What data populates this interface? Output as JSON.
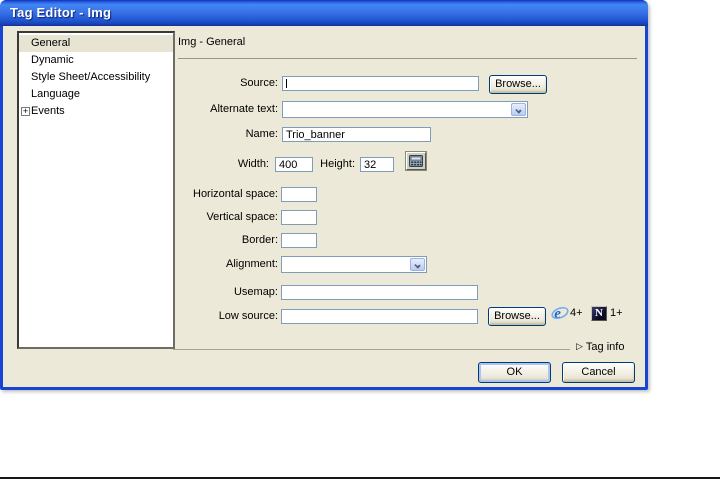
{
  "window": {
    "title": "Tag Editor - Img"
  },
  "sidebar": {
    "expander_glyph": "+",
    "items": [
      {
        "label": "General",
        "selected": true
      },
      {
        "label": "Dynamic"
      },
      {
        "label": "Style Sheet/Accessibility"
      },
      {
        "label": "Language"
      },
      {
        "label": "Events",
        "expandable": true
      }
    ]
  },
  "panel": {
    "header": "Img - General"
  },
  "form": {
    "source": {
      "label": "Source:",
      "value": "",
      "browse_label": "Browse..."
    },
    "alternate_text": {
      "label": "Alternate text:",
      "value": ""
    },
    "name": {
      "label": "Name:",
      "value": "Trio_banner"
    },
    "width": {
      "label": "Width:",
      "value": "400"
    },
    "height": {
      "label": "Height:",
      "value": "32"
    },
    "horizontal_space": {
      "label": "Horizontal space:",
      "value": ""
    },
    "vertical_space": {
      "label": "Vertical space:",
      "value": ""
    },
    "border": {
      "label": "Border:",
      "value": ""
    },
    "alignment": {
      "label": "Alignment:",
      "value": ""
    },
    "usemap": {
      "label": "Usemap:",
      "value": ""
    },
    "low_source": {
      "label": "Low source:",
      "value": "",
      "browse_label": "Browse..."
    },
    "browser_support": {
      "ie_version": "4+",
      "netscape_letter": "N",
      "netscape_version": "1+"
    }
  },
  "footer": {
    "tag_info_icon": "▷",
    "tag_info_label": "Tag info",
    "ok_label": "OK",
    "cancel_label": "Cancel"
  },
  "colors": {
    "titlebar_blue": "#3873e9",
    "dialog_border": "#1746d4",
    "client_bg": "#ece9d8",
    "input_border": "#7f9db9",
    "button_border": "#003c74"
  }
}
